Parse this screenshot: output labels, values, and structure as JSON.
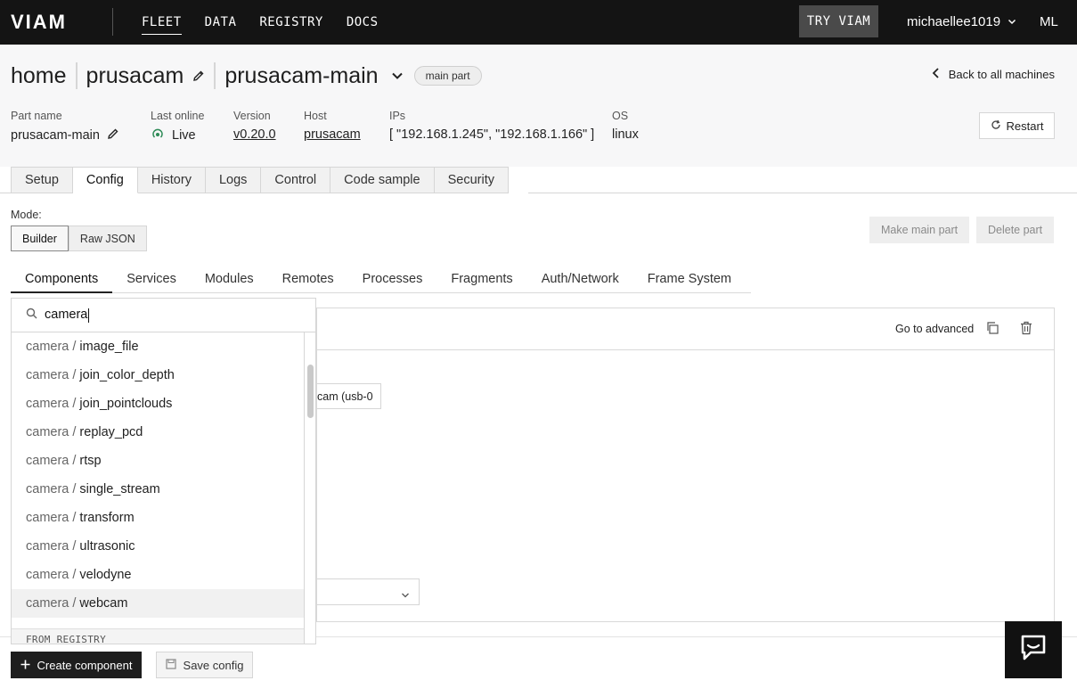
{
  "topnav": {
    "logo_text": "VIAM",
    "links": [
      {
        "label": "FLEET",
        "active": true
      },
      {
        "label": "DATA"
      },
      {
        "label": "REGISTRY"
      },
      {
        "label": "DOCS"
      }
    ],
    "try_button": "TRY VIAM",
    "username": "michaellee1019",
    "initials": "ML"
  },
  "header": {
    "location": "home",
    "machine": "prusacam",
    "part": "prusacam-main",
    "part_badge": "main part",
    "back_link": "Back to all machines",
    "meta": {
      "part_name_label": "Part name",
      "part_name": "prusacam-main",
      "last_online_label": "Last online",
      "last_online": "Live",
      "version_label": "Version",
      "version": "v0.20.0",
      "host_label": "Host",
      "host": "prusacam",
      "ips_label": "IPs",
      "ips": "[ \"192.168.1.245\", \"192.168.1.166\" ]",
      "os_label": "OS",
      "os": "linux"
    },
    "restart_label": "Restart"
  },
  "tabs": [
    "Setup",
    "Config",
    "History",
    "Logs",
    "Control",
    "Code sample",
    "Security"
  ],
  "active_tab": "Config",
  "mode": {
    "label": "Mode:",
    "options": [
      "Builder",
      "Raw JSON"
    ],
    "active": "Builder"
  },
  "part_actions": {
    "make_main": "Make main part",
    "delete": "Delete part"
  },
  "subtabs": [
    "Components",
    "Services",
    "Modules",
    "Remotes",
    "Processes",
    "Fragments",
    "Auth/Network",
    "Frame System"
  ],
  "active_subtab": "Components",
  "card": {
    "go_advanced": "Go to advanced",
    "chip_text": "cam (usb-0"
  },
  "dropdown": {
    "query": "camera",
    "prefix": "camera /",
    "items": [
      "image_file",
      "join_color_depth",
      "join_pointclouds",
      "replay_pcd",
      "rtsp",
      "single_stream",
      "transform",
      "ultrasonic",
      "velodyne",
      "webcam"
    ],
    "hovered": "webcam",
    "section_header": "FROM REGISTRY"
  },
  "bottom": {
    "create_label": "Create component",
    "save_label": "Save config"
  },
  "colors": {
    "live_green": "#2e8b57",
    "nav_bg": "#141414"
  }
}
